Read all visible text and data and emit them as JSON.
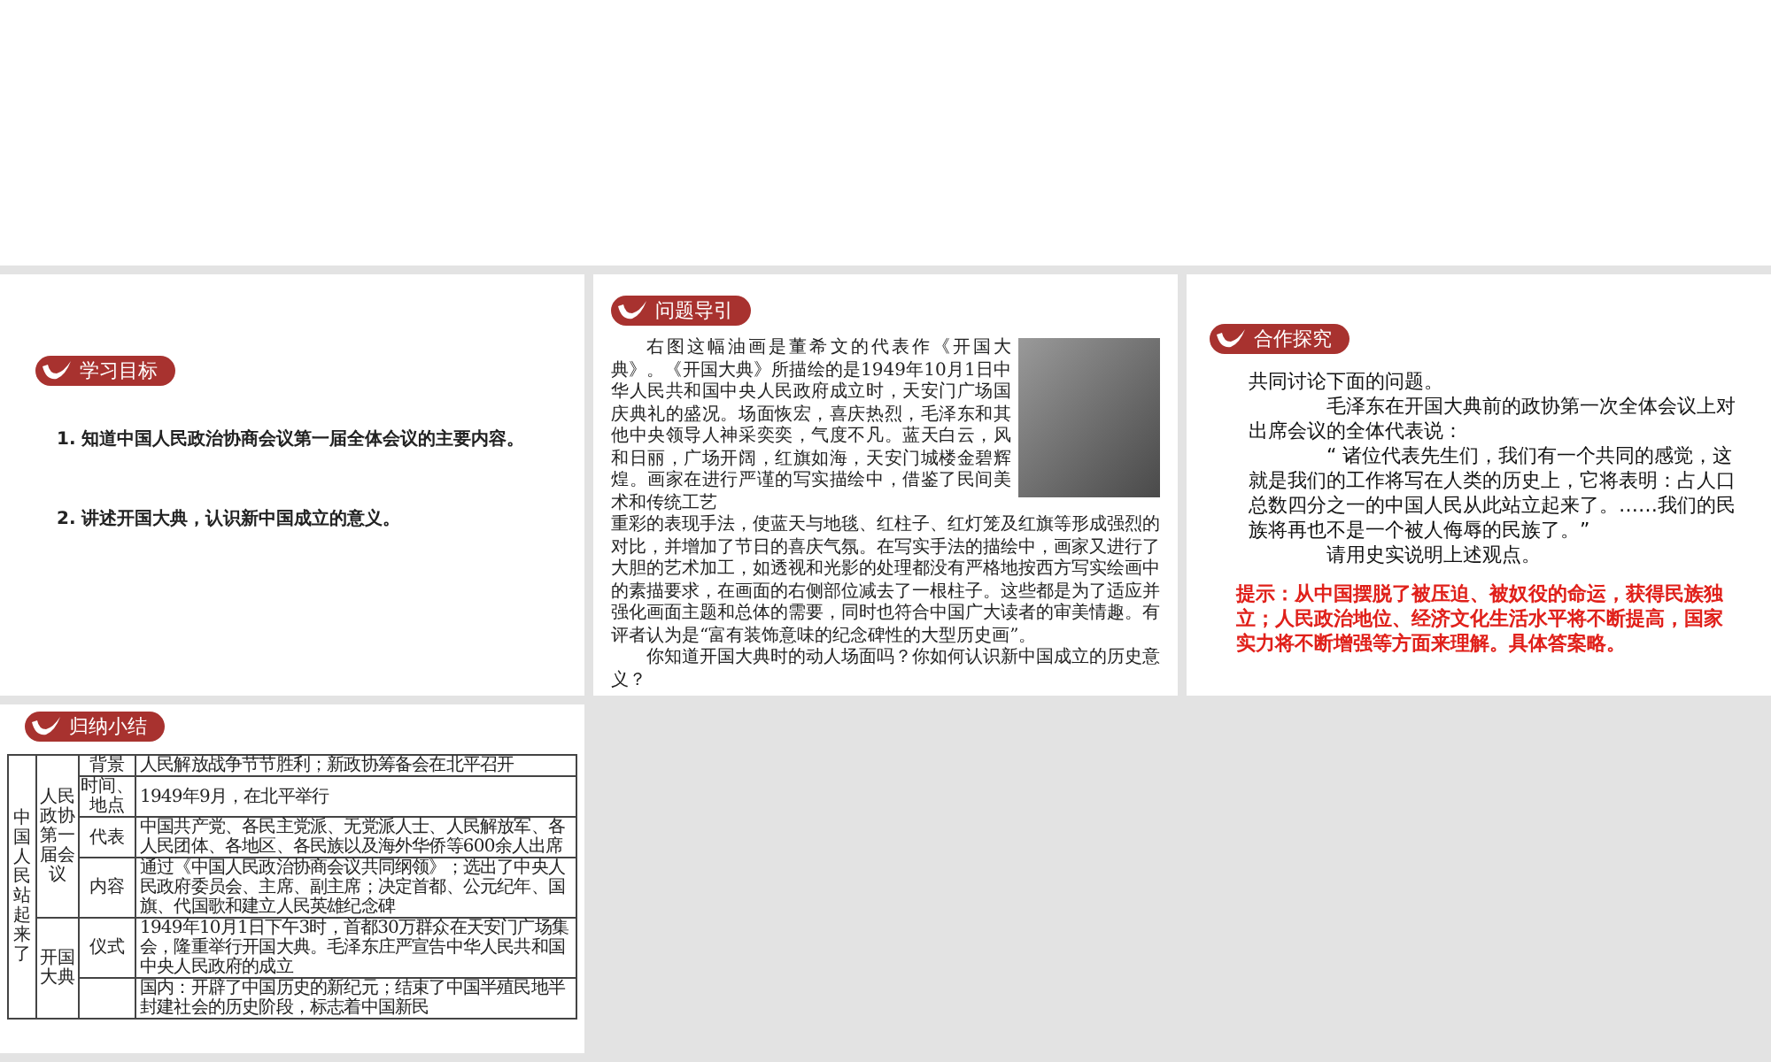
{
  "slides": [
    {
      "kind": "objectives",
      "badge": "学习目标",
      "items": [
        "1. 知道中国人民政治协商会议第一届全体会议的主要内容。",
        "2. 讲述开国大典，认识新中国成立的意义。"
      ]
    },
    {
      "kind": "guide",
      "badge": "问题导引",
      "paragraphs": [
        {
          "text": "右图这幅油画是董希文的代表作《开国大典》。《开国大典》所描绘的是1949年10月1日中华人民共和国中央人民政府成立时，天安门广场国庆典礼的盛况。场面恢宏，喜庆热烈，毛泽东和其他中央领导人神采奕奕，气度不凡。蓝天白云，风和日丽，广场开阔，红旗如海，天安门城楼金碧辉煌。画家在进行严谨的写实描绘中，借鉴了民间美术和传统工艺",
          "indent": true
        },
        {
          "text": "重彩的表现手法，使蓝天与地毯、红柱子、红灯笼及红旗等形成强烈的对比，并增加了节日的喜庆气氛。在写实手法的描绘中，画家又进行了大胆的艺术加工，如透视和光影的处理都没有严格地按西方写实绘画中的素描要求，在画面的右侧部位减去了一根柱子。这些都是为了适应并强化画面主题和总体的需要，同时也符合中国广大读者的审美情趣。有评者认为是“富有装饰意味的纪念碑性的大型历史画”。",
          "indent": false
        },
        {
          "text": "你知道开国大典时的动人场面吗？你如何认识新中国成立的历史意义？",
          "indent": true
        }
      ]
    },
    {
      "kind": "discussion",
      "badge": "合作探究",
      "paragraphs": [
        {
          "text": "共同讨论下面的问题。",
          "indent": false
        },
        {
          "text": "毛泽东在开国大典前的政协第一次全体会议上对出席会议的全体代表说：",
          "indent": true
        },
        {
          "text": "“ 诸位代表先生们，我们有一个共同的感觉，这就是我们的工作将写在人类的历史上，它将表明：占人口总数四分之一的中国人民从此站立起来了。……我们的民族将再也不是一个被人侮辱的民族了。”",
          "indent": true
        },
        {
          "text": "请用史实说明上述观点。",
          "indent": true
        }
      ],
      "hint": "提示：从中国摆脱了被压迫、被奴役的命运，获得民族独立；人民政治地位、经济文化生活水平将不断提高，国家实力将不断增强等方面来理解。具体答案略。"
    },
    {
      "kind": "summary",
      "badge": "归纳小结",
      "table": {
        "group": "中国人民站起来了",
        "sections": [
          {
            "heading": "人民政协第一届会议",
            "rows": [
              {
                "label": "背景",
                "text": "人民解放战争节节胜利；新政协筹备会在北平召开"
              },
              {
                "label": "时间、地点",
                "text": "1949年9月，在北平举行"
              },
              {
                "label": "代表",
                "text": "中国共产党、各民主党派、无党派人士、人民解放军、各人民团体、各地区、各民族以及海外华侨等600余人出席"
              },
              {
                "label": "内容",
                "text": "通过《中国人民政治协商会议共同纲领》；选出了中央人民政府委员会、主席、副主席；决定首都、公元纪年、国旗、代国歌和建立人民英雄纪念碑"
              }
            ]
          },
          {
            "heading": "开国大典",
            "rows": [
              {
                "label": "仪式",
                "text": "1949年10月1日下午3时，首都30万群众在天安门广场集会，隆重举行开国大典。毛泽东庄严宣告中华人民共和国中央人民政府的成立"
              },
              {
                "text": "国内：开辟了中国历史的新纪元；结束了中国半殖民地半封建社会的历史阶段，标志着中国新民"
              }
            ]
          }
        ]
      }
    }
  ]
}
